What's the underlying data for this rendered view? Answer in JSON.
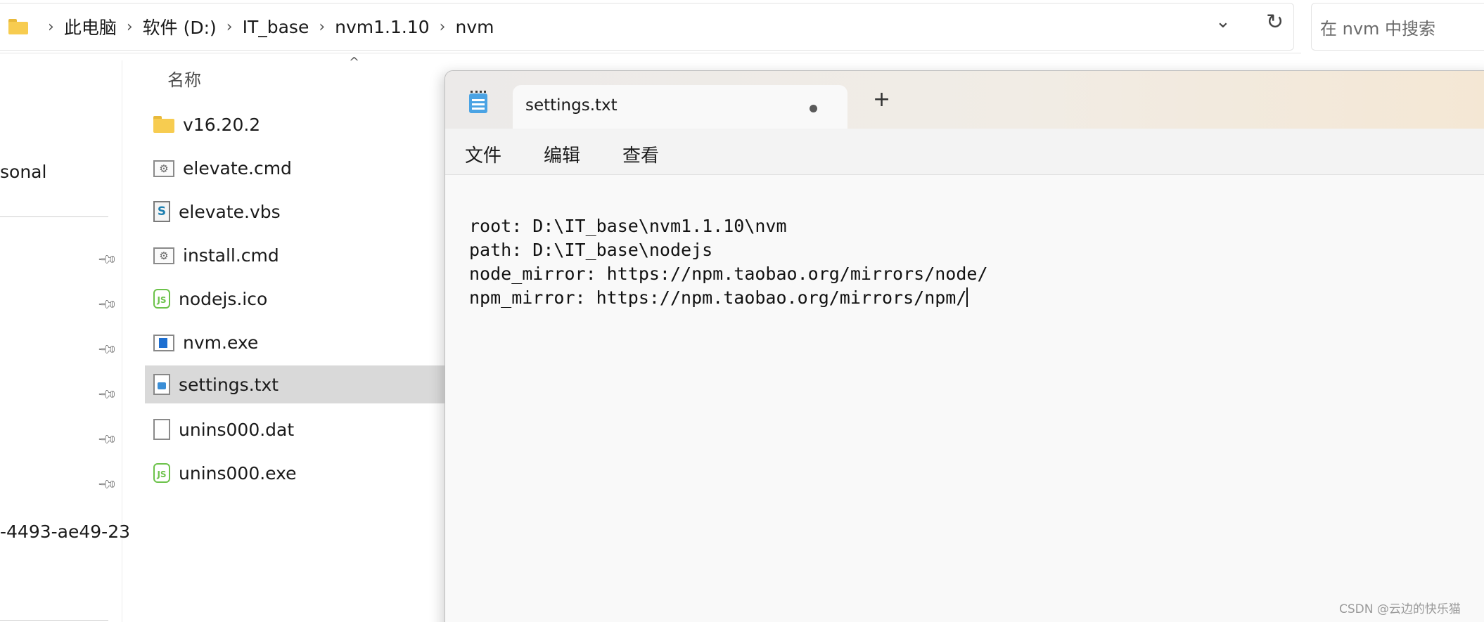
{
  "explorer": {
    "breadcrumbs": [
      "此电脑",
      "软件 (D:)",
      "IT_base",
      "nvm1.1.10",
      "nvm"
    ],
    "search_placeholder": "在 nvm 中搜索",
    "column_header_name": "名称",
    "nav_pane": {
      "partial_item": "sonal",
      "partial_bottom_item": "-4493-ae49-23"
    },
    "files": [
      {
        "name": "v16.20.2",
        "icon": "folder-icon"
      },
      {
        "name": "elevate.cmd",
        "icon": "cmd-file-icon"
      },
      {
        "name": "elevate.vbs",
        "icon": "vbs-file-icon"
      },
      {
        "name": "install.cmd",
        "icon": "cmd-file-icon"
      },
      {
        "name": "nodejs.ico",
        "icon": "nodejs-icon"
      },
      {
        "name": "nvm.exe",
        "icon": "exe-file-icon"
      },
      {
        "name": "settings.txt",
        "icon": "text-file-icon",
        "selected": true
      },
      {
        "name": "unins000.dat",
        "icon": "blank-file-icon"
      },
      {
        "name": "unins000.exe",
        "icon": "nodejs-icon"
      }
    ]
  },
  "notepad": {
    "tab_title": "settings.txt",
    "new_tab_glyph": "+",
    "menu": [
      "文件",
      "编辑",
      "查看"
    ],
    "lines": [
      "root: D:\\IT_base\\nvm1.1.10\\nvm",
      "path: D:\\IT_base\\nodejs",
      "node_mirror: https://npm.taobao.org/mirrors/node/",
      "npm_mirror: https://npm.taobao.org/mirrors/npm/"
    ]
  },
  "watermark": "CSDN @云边的快乐猫",
  "colors": {
    "selected_row": "#d9d9d9",
    "folder": "#f7cc50",
    "node_green": "#6cc24a",
    "notepad_icon": "#4aa3e4"
  }
}
